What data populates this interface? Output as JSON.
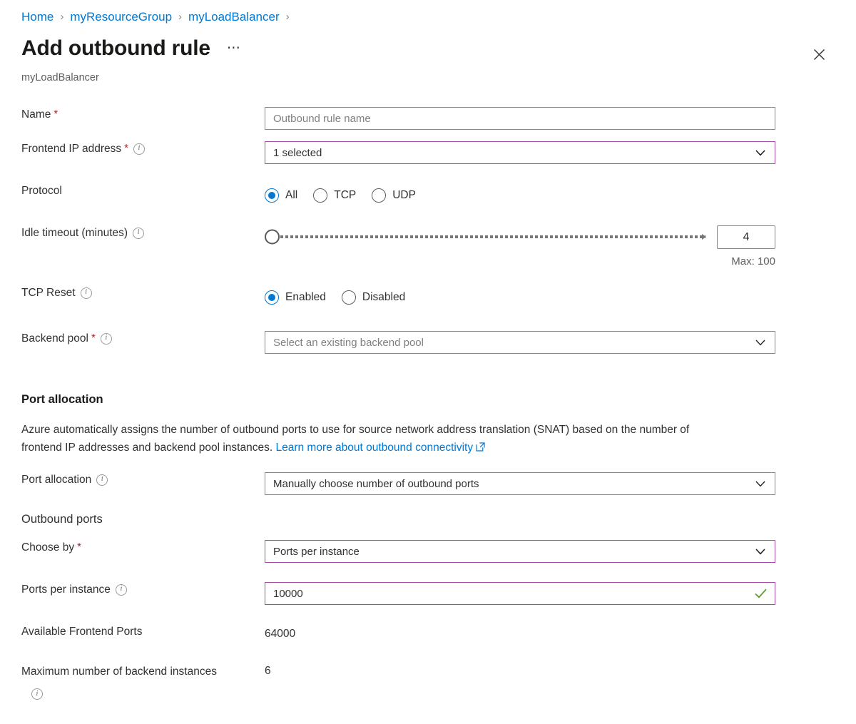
{
  "breadcrumb": {
    "items": [
      {
        "label": "Home"
      },
      {
        "label": "myResourceGroup"
      },
      {
        "label": "myLoadBalancer"
      }
    ],
    "separator": "›"
  },
  "header": {
    "title": "Add outbound rule",
    "more_label": "⋯",
    "subtitle": "myLoadBalancer",
    "close_label": "✕"
  },
  "colors": {
    "link": "#0078d4",
    "accent_focus": "#a64ca6",
    "required": "#a4262c",
    "radio_on": "#0078d4",
    "valid_check": "#5a9e29"
  },
  "form": {
    "name": {
      "label": "Name",
      "required": "*",
      "placeholder": "Outbound rule name",
      "value": ""
    },
    "frontend_ip": {
      "label": "Frontend IP address",
      "required": "*",
      "info": "info-icon",
      "value": "1 selected",
      "focused": true
    },
    "protocol": {
      "label": "Protocol",
      "options": [
        {
          "label": "All",
          "selected": true
        },
        {
          "label": "TCP",
          "selected": false
        },
        {
          "label": "UDP",
          "selected": false
        }
      ]
    },
    "idle_timeout": {
      "label": "Idle timeout (minutes)",
      "info": "info-icon",
      "value": "4",
      "min": 4,
      "max": 100,
      "max_label": "Max: 100"
    },
    "tcp_reset": {
      "label": "TCP Reset",
      "info": "info-icon",
      "options": [
        {
          "label": "Enabled",
          "selected": true
        },
        {
          "label": "Disabled",
          "selected": false
        }
      ]
    },
    "backend_pool": {
      "label": "Backend pool",
      "required": "*",
      "info": "info-icon",
      "placeholder": "Select an existing backend pool",
      "value": ""
    }
  },
  "port_allocation_section": {
    "heading": "Port allocation",
    "description_part1": "Azure automatically assigns the number of outbound ports to use for source network address translation (SNAT) based on the number of frontend IP addresses and backend pool instances.",
    "link_label": "Learn more about outbound connectivity",
    "link_icon": "external-link-icon",
    "port_allocation": {
      "label": "Port allocation",
      "info": "info-icon",
      "value": "Manually choose number of outbound ports"
    },
    "outbound_ports_heading": "Outbound ports",
    "choose_by": {
      "label": "Choose by",
      "required": "*",
      "value": "Ports per instance",
      "focused": true
    },
    "ports_per_instance": {
      "label": "Ports per instance",
      "info": "info-icon",
      "value": "10000",
      "focused": true,
      "valid": true,
      "valid_icon": "checkmark-icon"
    },
    "available_frontend_ports": {
      "label": "Available Frontend Ports",
      "value": "64000"
    },
    "max_backend_instances": {
      "label": "Maximum number of backend instances",
      "info": "info-icon",
      "value": "6"
    }
  }
}
